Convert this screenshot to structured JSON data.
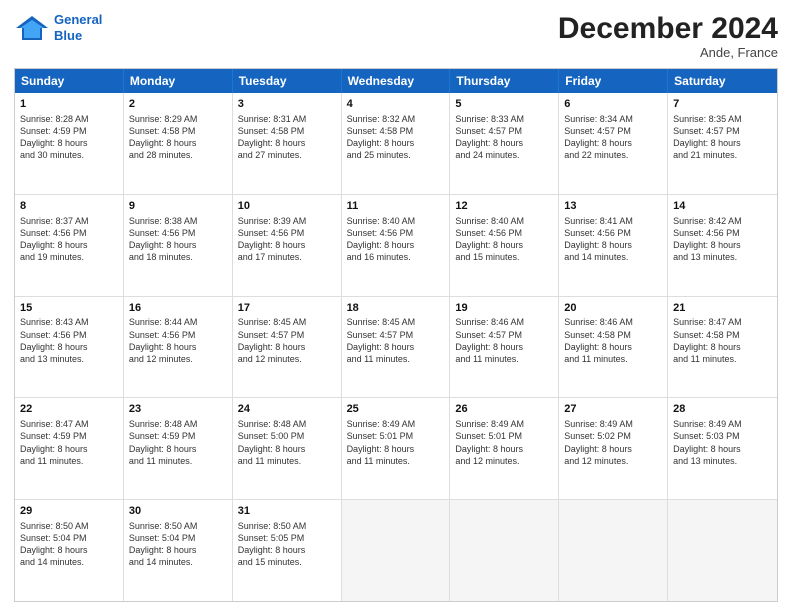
{
  "header": {
    "logo_line1": "General",
    "logo_line2": "Blue",
    "month_title": "December 2024",
    "location": "Ande, France"
  },
  "weekdays": [
    "Sunday",
    "Monday",
    "Tuesday",
    "Wednesday",
    "Thursday",
    "Friday",
    "Saturday"
  ],
  "rows": [
    [
      {
        "day": "1",
        "lines": [
          "Sunrise: 8:28 AM",
          "Sunset: 4:59 PM",
          "Daylight: 8 hours",
          "and 30 minutes."
        ]
      },
      {
        "day": "2",
        "lines": [
          "Sunrise: 8:29 AM",
          "Sunset: 4:58 PM",
          "Daylight: 8 hours",
          "and 28 minutes."
        ]
      },
      {
        "day": "3",
        "lines": [
          "Sunrise: 8:31 AM",
          "Sunset: 4:58 PM",
          "Daylight: 8 hours",
          "and 27 minutes."
        ]
      },
      {
        "day": "4",
        "lines": [
          "Sunrise: 8:32 AM",
          "Sunset: 4:58 PM",
          "Daylight: 8 hours",
          "and 25 minutes."
        ]
      },
      {
        "day": "5",
        "lines": [
          "Sunrise: 8:33 AM",
          "Sunset: 4:57 PM",
          "Daylight: 8 hours",
          "and 24 minutes."
        ]
      },
      {
        "day": "6",
        "lines": [
          "Sunrise: 8:34 AM",
          "Sunset: 4:57 PM",
          "Daylight: 8 hours",
          "and 22 minutes."
        ]
      },
      {
        "day": "7",
        "lines": [
          "Sunrise: 8:35 AM",
          "Sunset: 4:57 PM",
          "Daylight: 8 hours",
          "and 21 minutes."
        ]
      }
    ],
    [
      {
        "day": "8",
        "lines": [
          "Sunrise: 8:37 AM",
          "Sunset: 4:56 PM",
          "Daylight: 8 hours",
          "and 19 minutes."
        ]
      },
      {
        "day": "9",
        "lines": [
          "Sunrise: 8:38 AM",
          "Sunset: 4:56 PM",
          "Daylight: 8 hours",
          "and 18 minutes."
        ]
      },
      {
        "day": "10",
        "lines": [
          "Sunrise: 8:39 AM",
          "Sunset: 4:56 PM",
          "Daylight: 8 hours",
          "and 17 minutes."
        ]
      },
      {
        "day": "11",
        "lines": [
          "Sunrise: 8:40 AM",
          "Sunset: 4:56 PM",
          "Daylight: 8 hours",
          "and 16 minutes."
        ]
      },
      {
        "day": "12",
        "lines": [
          "Sunrise: 8:40 AM",
          "Sunset: 4:56 PM",
          "Daylight: 8 hours",
          "and 15 minutes."
        ]
      },
      {
        "day": "13",
        "lines": [
          "Sunrise: 8:41 AM",
          "Sunset: 4:56 PM",
          "Daylight: 8 hours",
          "and 14 minutes."
        ]
      },
      {
        "day": "14",
        "lines": [
          "Sunrise: 8:42 AM",
          "Sunset: 4:56 PM",
          "Daylight: 8 hours",
          "and 13 minutes."
        ]
      }
    ],
    [
      {
        "day": "15",
        "lines": [
          "Sunrise: 8:43 AM",
          "Sunset: 4:56 PM",
          "Daylight: 8 hours",
          "and 13 minutes."
        ]
      },
      {
        "day": "16",
        "lines": [
          "Sunrise: 8:44 AM",
          "Sunset: 4:56 PM",
          "Daylight: 8 hours",
          "and 12 minutes."
        ]
      },
      {
        "day": "17",
        "lines": [
          "Sunrise: 8:45 AM",
          "Sunset: 4:57 PM",
          "Daylight: 8 hours",
          "and 12 minutes."
        ]
      },
      {
        "day": "18",
        "lines": [
          "Sunrise: 8:45 AM",
          "Sunset: 4:57 PM",
          "Daylight: 8 hours",
          "and 11 minutes."
        ]
      },
      {
        "day": "19",
        "lines": [
          "Sunrise: 8:46 AM",
          "Sunset: 4:57 PM",
          "Daylight: 8 hours",
          "and 11 minutes."
        ]
      },
      {
        "day": "20",
        "lines": [
          "Sunrise: 8:46 AM",
          "Sunset: 4:58 PM",
          "Daylight: 8 hours",
          "and 11 minutes."
        ]
      },
      {
        "day": "21",
        "lines": [
          "Sunrise: 8:47 AM",
          "Sunset: 4:58 PM",
          "Daylight: 8 hours",
          "and 11 minutes."
        ]
      }
    ],
    [
      {
        "day": "22",
        "lines": [
          "Sunrise: 8:47 AM",
          "Sunset: 4:59 PM",
          "Daylight: 8 hours",
          "and 11 minutes."
        ]
      },
      {
        "day": "23",
        "lines": [
          "Sunrise: 8:48 AM",
          "Sunset: 4:59 PM",
          "Daylight: 8 hours",
          "and 11 minutes."
        ]
      },
      {
        "day": "24",
        "lines": [
          "Sunrise: 8:48 AM",
          "Sunset: 5:00 PM",
          "Daylight: 8 hours",
          "and 11 minutes."
        ]
      },
      {
        "day": "25",
        "lines": [
          "Sunrise: 8:49 AM",
          "Sunset: 5:01 PM",
          "Daylight: 8 hours",
          "and 11 minutes."
        ]
      },
      {
        "day": "26",
        "lines": [
          "Sunrise: 8:49 AM",
          "Sunset: 5:01 PM",
          "Daylight: 8 hours",
          "and 12 minutes."
        ]
      },
      {
        "day": "27",
        "lines": [
          "Sunrise: 8:49 AM",
          "Sunset: 5:02 PM",
          "Daylight: 8 hours",
          "and 12 minutes."
        ]
      },
      {
        "day": "28",
        "lines": [
          "Sunrise: 8:49 AM",
          "Sunset: 5:03 PM",
          "Daylight: 8 hours",
          "and 13 minutes."
        ]
      }
    ],
    [
      {
        "day": "29",
        "lines": [
          "Sunrise: 8:50 AM",
          "Sunset: 5:04 PM",
          "Daylight: 8 hours",
          "and 14 minutes."
        ]
      },
      {
        "day": "30",
        "lines": [
          "Sunrise: 8:50 AM",
          "Sunset: 5:04 PM",
          "Daylight: 8 hours",
          "and 14 minutes."
        ]
      },
      {
        "day": "31",
        "lines": [
          "Sunrise: 8:50 AM",
          "Sunset: 5:05 PM",
          "Daylight: 8 hours",
          "and 15 minutes."
        ]
      },
      {
        "day": "",
        "lines": []
      },
      {
        "day": "",
        "lines": []
      },
      {
        "day": "",
        "lines": []
      },
      {
        "day": "",
        "lines": []
      }
    ]
  ]
}
